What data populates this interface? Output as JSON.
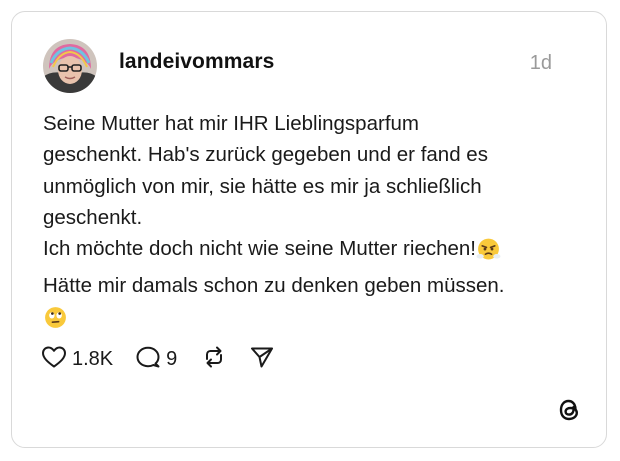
{
  "post": {
    "username": "landeivommars",
    "timestamp": "1d",
    "text_lines": [
      "Seine Mutter hat mir IHR Lieblingsparfum",
      "geschenkt. Hab's zurück gegeben und er fand es",
      "unmöglich von mir, sie hätte es mir ja schließlich",
      "geschenkt.",
      "Ich möchte doch nicht wie seine Mutter riechen!",
      "Hätte mir damals schon zu denken geben müssen."
    ],
    "emojis": [
      "face-with-steam-from-nose-emoji",
      "face-with-rolling-eyes-emoji"
    ]
  },
  "actions": {
    "like_count": "1.8K",
    "reply_count": "9",
    "icons": [
      "heart-icon",
      "reply-bubble-icon",
      "repost-icon",
      "share-send-icon"
    ]
  },
  "brand": {
    "logo": "threads-logo-icon"
  },
  "colors": {
    "text": "#1a1a1a",
    "muted": "#9a9a9a",
    "border": "#d9d9d9",
    "background": "#ffffff"
  }
}
